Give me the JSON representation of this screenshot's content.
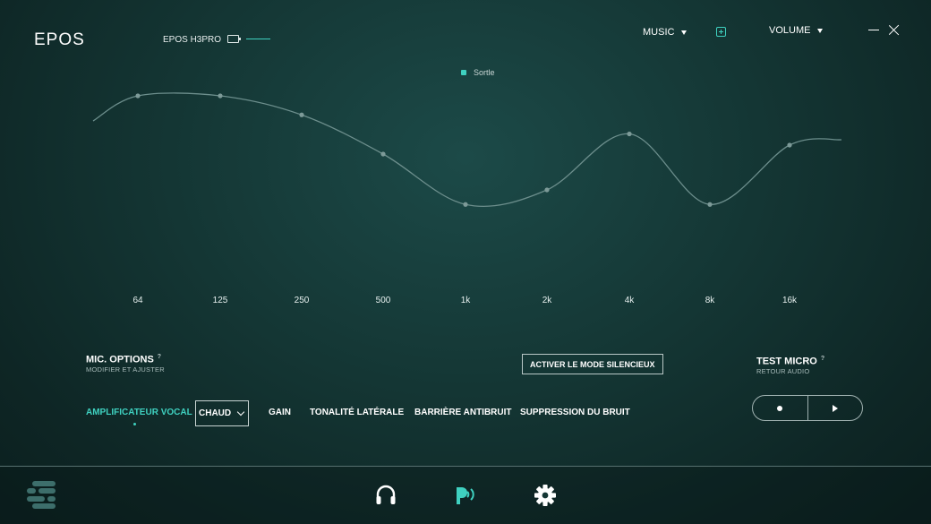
{
  "header": {
    "logo": "EPOS",
    "device_name": "EPOS H3PRO",
    "preset_dropdown": "MUSIC",
    "mode_dropdown": "VOLUME",
    "icons": [
      "battery-icon",
      "add-preset-icon",
      "minimize-icon",
      "close-icon"
    ]
  },
  "equalizer": {
    "legend": "Sortle",
    "frequencies": [
      "64",
      "125",
      "250",
      "500",
      "1k",
      "2k",
      "4k",
      "8k",
      "16k"
    ],
    "levels_relative": [
      0.72,
      0.72,
      0.55,
      0.2,
      -0.25,
      -0.12,
      0.38,
      -0.25,
      0.28
    ],
    "accent_color": "#3fd1c0",
    "curve_color": "#6c8e8c"
  },
  "mic": {
    "title": "MIC. OPTIONS",
    "subtitle": "MODIFIER ET AJUSTER",
    "help": "?",
    "mute_button": "ACTIVER LE MODE SILENCIEUX",
    "tabs": {
      "voice_amp": "AMPLIFICATEUR VOCAL",
      "gain": "GAIN",
      "sidetone": "TONALITÉ LATÉRALE",
      "noise_gate": "BARRIÈRE ANTIBRUIT",
      "noise_suppression": "SUPPRESSION DU BRUIT"
    },
    "voice_preset": "CHAUD"
  },
  "test_micro": {
    "title": "TEST MICRO",
    "subtitle": "RETOUR AUDIO",
    "help": "?"
  },
  "footer": {
    "icons": [
      "menu-icon",
      "headphones-icon",
      "microphone-icon",
      "settings-icon"
    ],
    "active": "microphone-icon"
  }
}
